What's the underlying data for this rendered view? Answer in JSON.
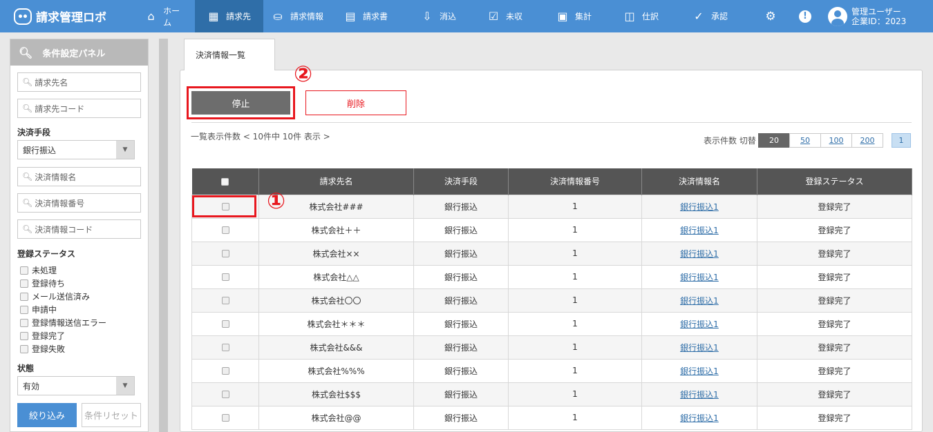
{
  "app": {
    "title": "請求管理ロボ"
  },
  "nav": {
    "items": [
      {
        "label": "ホーム",
        "icon": "home-icon"
      },
      {
        "label": "請求先",
        "icon": "building-icon"
      },
      {
        "label": "請求情報",
        "icon": "drive-icon"
      },
      {
        "label": "請求書",
        "icon": "document-list-icon"
      },
      {
        "label": "消込",
        "icon": "download-icon"
      },
      {
        "label": "未収",
        "icon": "checkbox-icon"
      },
      {
        "label": "集計",
        "icon": "calculator-icon"
      },
      {
        "label": "仕訳",
        "icon": "columns-icon"
      },
      {
        "label": "承認",
        "icon": "check-circle-icon"
      }
    ],
    "active_index": 1,
    "user_name": "管理ユーザー",
    "company_id": "企業ID：2023"
  },
  "sidebar": {
    "title": "条件設定パネル",
    "billing_name_placeholder": "請求先名",
    "billing_code_placeholder": "請求先コード",
    "payment_method_label": "決済手段",
    "payment_method_value": "銀行振込",
    "payment_info_name_placeholder": "決済情報名",
    "payment_info_number_placeholder": "決済情報番号",
    "payment_info_code_placeholder": "決済情報コード",
    "status_label": "登録ステータス",
    "statuses": [
      "未処理",
      "登録待ち",
      "メール送信済み",
      "申請中",
      "登録情報送信エラー",
      "登録完了",
      "登録失敗"
    ],
    "state_label": "状態",
    "state_value": "有効",
    "filter_button": "絞り込み",
    "reset_button": "条件リセット"
  },
  "main": {
    "tab_label": "決済情報一覧",
    "stop_button": "停止",
    "delete_button": "削除",
    "annotation_1": "①",
    "annotation_2": "②",
    "count_text": "一覧表示件数 < 10件中 10件 表示 >",
    "per_page_label": "表示件数 切替",
    "per_page_options": [
      "20",
      "50",
      "100",
      "200"
    ],
    "per_page_selected": "20",
    "current_page": "1"
  },
  "table": {
    "headers": [
      "請求先名",
      "決済手段",
      "決済情報番号",
      "決済情報名",
      "登録ステータス"
    ],
    "rows": [
      {
        "name": "株式会社###",
        "method": "銀行振込",
        "number": "1",
        "info": "銀行振込1",
        "status": "登録完了"
      },
      {
        "name": "株式会社＋＋",
        "method": "銀行振込",
        "number": "1",
        "info": "銀行振込1",
        "status": "登録完了"
      },
      {
        "name": "株式会社××",
        "method": "銀行振込",
        "number": "1",
        "info": "銀行振込1",
        "status": "登録完了"
      },
      {
        "name": "株式会社△△",
        "method": "銀行振込",
        "number": "1",
        "info": "銀行振込1",
        "status": "登録完了"
      },
      {
        "name": "株式会社〇〇",
        "method": "銀行振込",
        "number": "1",
        "info": "銀行振込1",
        "status": "登録完了"
      },
      {
        "name": "株式会社＊＊＊",
        "method": "銀行振込",
        "number": "1",
        "info": "銀行振込1",
        "status": "登録完了"
      },
      {
        "name": "株式会社&&&",
        "method": "銀行振込",
        "number": "1",
        "info": "銀行振込1",
        "status": "登録完了"
      },
      {
        "name": "株式会社%%%",
        "method": "銀行振込",
        "number": "1",
        "info": "銀行振込1",
        "status": "登録完了"
      },
      {
        "name": "株式会社$$$",
        "method": "銀行振込",
        "number": "1",
        "info": "銀行振込1",
        "status": "登録完了"
      },
      {
        "name": "株式会社@@",
        "method": "銀行振込",
        "number": "1",
        "info": "銀行振込1",
        "status": "登録完了"
      }
    ]
  },
  "colors": {
    "nav": "#4a8fd4",
    "nav_active": "#2f6ea8",
    "annotation": "#e8171e",
    "table_header": "#555555"
  }
}
